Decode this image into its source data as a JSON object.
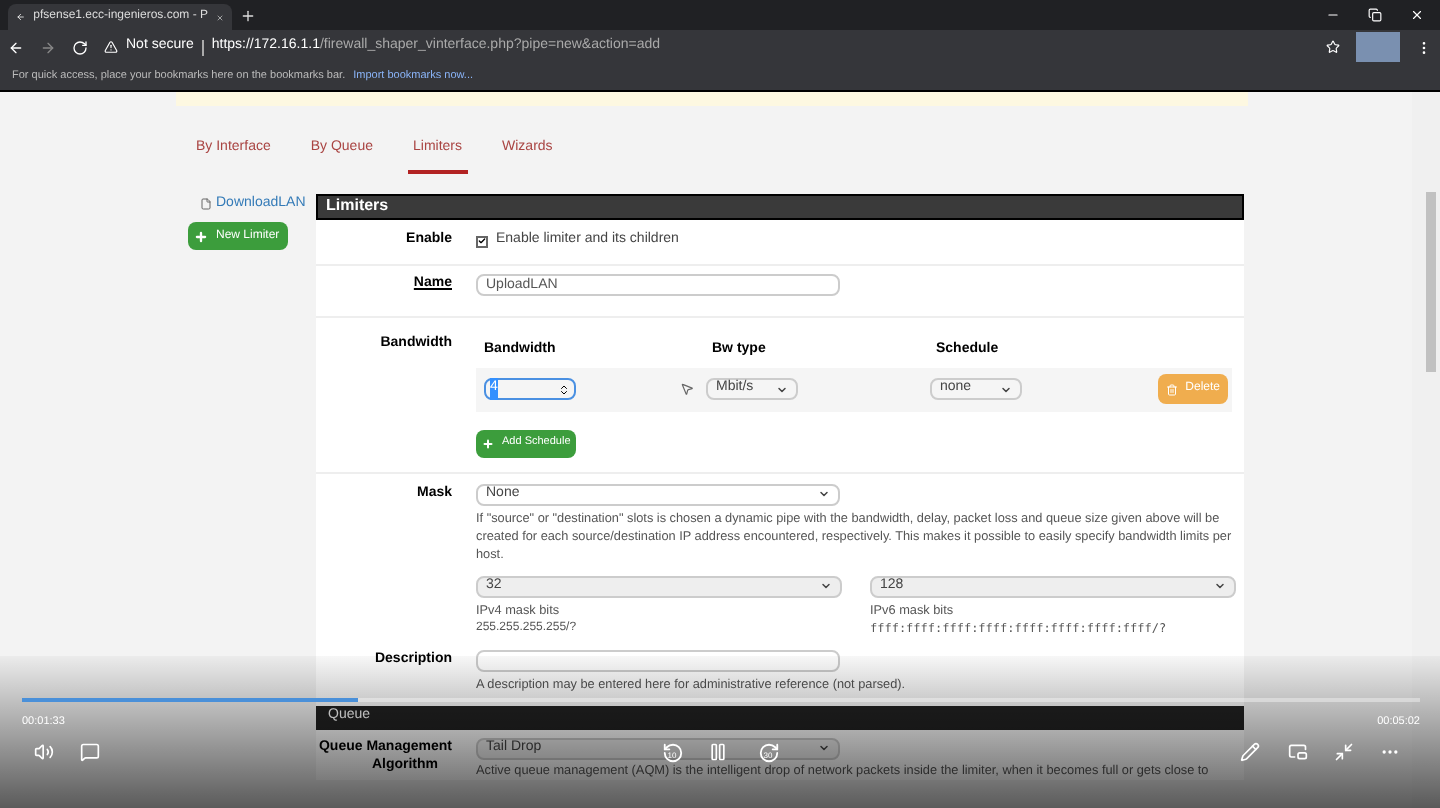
{
  "browser": {
    "tab_title": "pfsense1.ecc-ingenieros.com - P",
    "not_secure": "Not secure",
    "url_host": "https://172.16.1.1",
    "url_path": "/firewall_shaper_vinterface.php?pipe=new&action=add",
    "bookmarks_hint": "For quick access, place your bookmarks here on the bookmarks bar.",
    "import_link": "Import bookmarks now..."
  },
  "nav_tabs": [
    {
      "label": "By Interface",
      "selected": false
    },
    {
      "label": "By Queue",
      "selected": false
    },
    {
      "label": "Limiters",
      "selected": true
    },
    {
      "label": "Wizards",
      "selected": false
    }
  ],
  "sidebar": {
    "items": [
      "DownloadLAN"
    ],
    "new_button": "New Limiter"
  },
  "panel": {
    "title": "Limiters",
    "enable": {
      "label": "Enable",
      "checkbox_label": "Enable limiter and its children",
      "checked": true
    },
    "name": {
      "label": "Name",
      "value": "UploadLAN"
    },
    "bandwidth": {
      "label": "Bandwidth",
      "columns": [
        "Bandwidth",
        "Bw type",
        "Schedule"
      ],
      "value": "4",
      "bw_type": "Mbit/s",
      "schedule": "none",
      "delete": "Delete",
      "add": "Add Schedule"
    },
    "mask": {
      "label": "Mask",
      "value": "None",
      "help": "If \"source\" or \"destination\" slots is chosen a dynamic pipe with the bandwidth, delay, packet loss and queue size given above will be created for each source/destination IP address encountered, respectively. This makes it possible to easily specify bandwidth limits per host.",
      "ipv4": {
        "value": "32",
        "label": "IPv4 mask bits",
        "hint": "255.255.255.255/?"
      },
      "ipv6": {
        "value": "128",
        "label": "IPv6 mask bits",
        "hint": "ffff:ffff:ffff:ffff:ffff:ffff:ffff:ffff/?"
      }
    },
    "description": {
      "label": "Description",
      "help": "A description may be entered here for administrative reference (not parsed)."
    }
  },
  "queue": {
    "title": "Queue",
    "label_line1": "Queue Management",
    "label_line2": "Algorithm",
    "value": "Tail Drop",
    "help": "Active queue management (AQM) is the intelligent drop of network packets inside the limiter, when it becomes full or gets close to"
  },
  "video": {
    "elapsed": "00:01:33",
    "total": "00:05:02",
    "level": 0.24,
    "skip_back": "10",
    "skip_forward": "30"
  }
}
